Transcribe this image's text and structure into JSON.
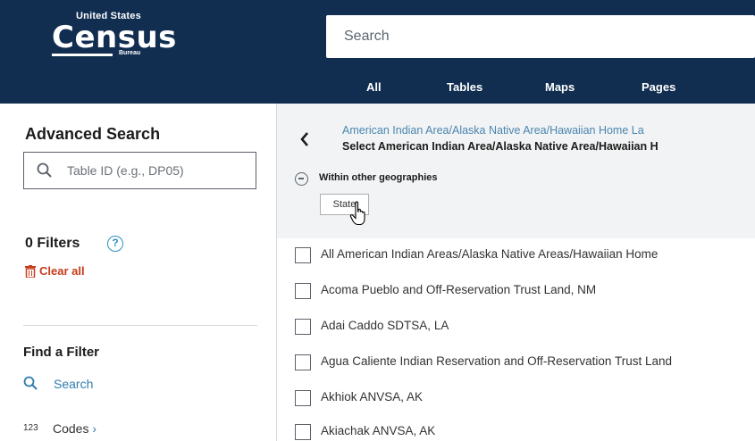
{
  "header": {
    "logo": {
      "top": "United States",
      "name": "Census",
      "bottom": "Bureau"
    },
    "search_placeholder": "Search"
  },
  "nav": {
    "tabs": [
      "All",
      "Tables",
      "Maps",
      "Pages"
    ]
  },
  "sidebar": {
    "title": "Advanced Search",
    "table_id_placeholder": "Table ID (e.g., DP05)",
    "filters_count": "0 Filters",
    "clear_all": "Clear all",
    "find_title": "Find a Filter",
    "find_search": "Search",
    "codes_icon": "123",
    "codes": "Codes"
  },
  "panel": {
    "crumb": "American Indian Area/Alaska Native Area/Hawaiian Home La",
    "subtitle": "Select American Indian Area/Alaska Native Area/Hawaiian H",
    "within": "Within other geographies",
    "state_button": "State"
  },
  "list": {
    "items": [
      "All American Indian Areas/Alaska Native Areas/Hawaiian Home",
      "Acoma Pueblo and Off-Reservation Trust Land, NM",
      "Adai Caddo SDTSA, LA",
      "Agua Caliente Indian Reservation and Off-Reservation Trust Land",
      "Akhiok ANVSA, AK",
      "Akiachak ANVSA, AK"
    ]
  },
  "colors": {
    "brand": "#112e51",
    "link": "#2e7dad",
    "danger": "#c63c1b",
    "panel_bg": "#f1f3f4"
  }
}
